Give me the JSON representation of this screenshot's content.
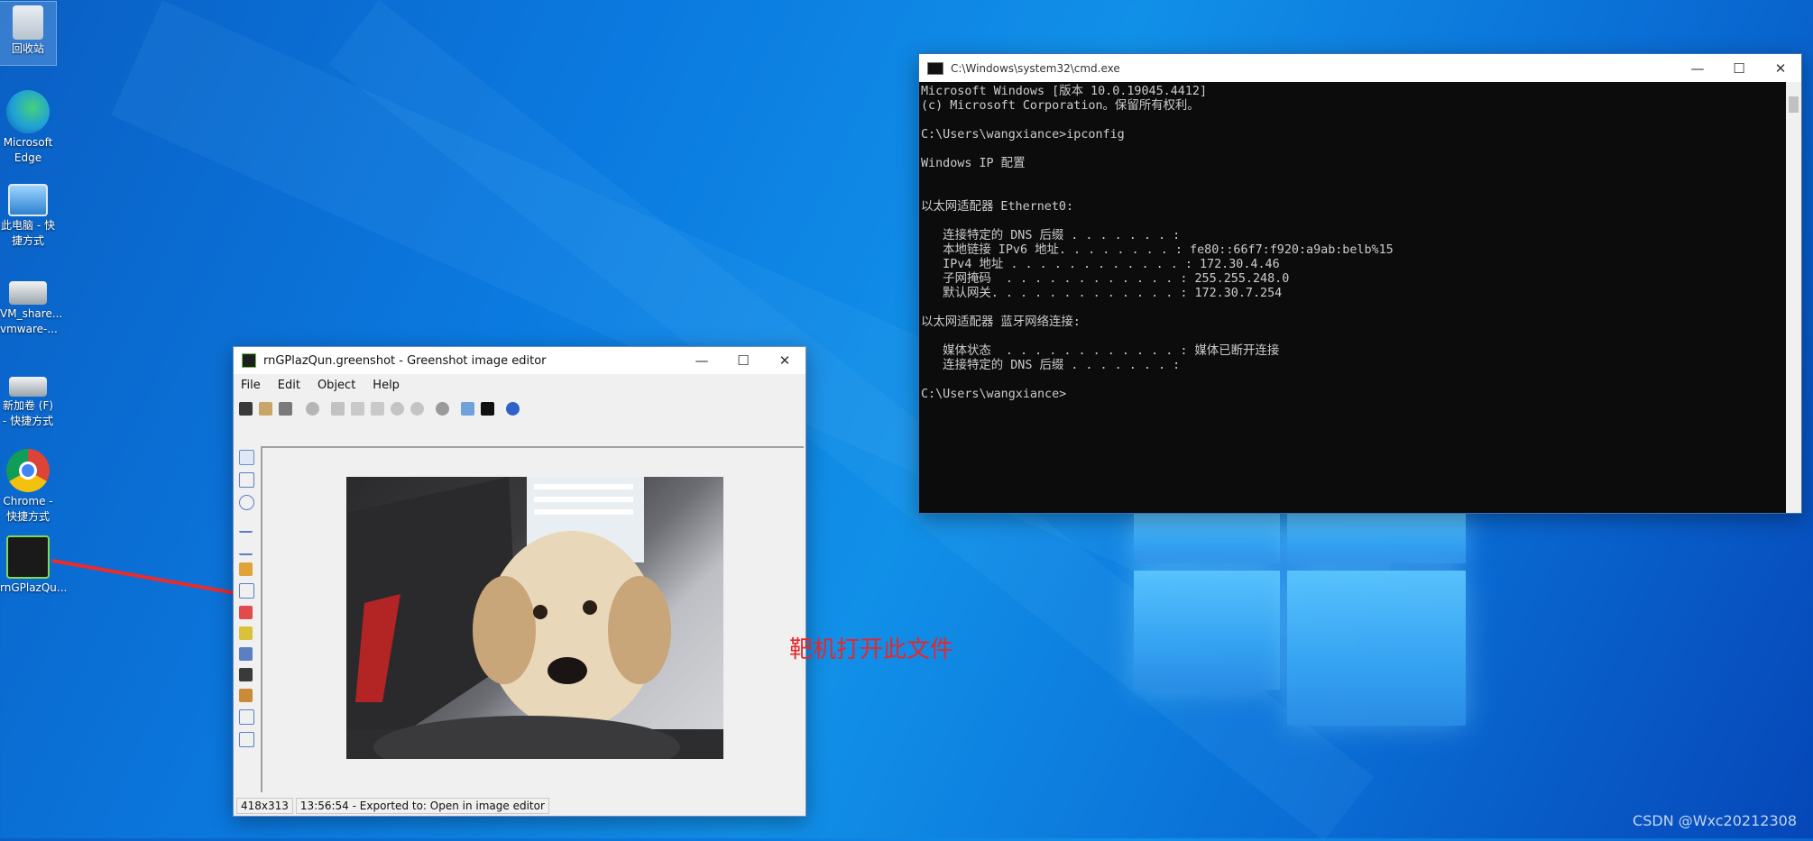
{
  "desktop": {
    "icons": [
      {
        "label": "回收站"
      },
      {
        "label": "Microsoft Edge"
      },
      {
        "label": "此电脑 - 快捷方式"
      },
      {
        "label": "VM_share... vmware-..."
      },
      {
        "label": "新加卷 (F) - 快捷方式"
      },
      {
        "label": "Chrome - 快捷方式"
      },
      {
        "label": "rnGPlazQu..."
      }
    ],
    "annotation_text": "靶机打开此文件",
    "watermark": "CSDN @Wxc20212308"
  },
  "cmd": {
    "title": "C:\\Windows\\system32\\cmd.exe",
    "lines": [
      "Microsoft Windows [版本 10.0.19045.4412]",
      "(c) Microsoft Corporation。保留所有权利。",
      "",
      "C:\\Users\\wangxiance>ipconfig",
      "",
      "Windows IP 配置",
      "",
      "",
      "以太网适配器 Ethernet0:",
      "",
      "   连接特定的 DNS 后缀 . . . . . . . :",
      "   本地链接 IPv6 地址. . . . . . . . : fe80::66f7:f920:a9ab:belb%15",
      "   IPv4 地址 . . . . . . . . . . . . : 172.30.4.46",
      "   子网掩码  . . . . . . . . . . . . : 255.255.248.0",
      "   默认网关. . . . . . . . . . . . . : 172.30.7.254",
      "",
      "以太网适配器 蓝牙网络连接:",
      "",
      "   媒体状态  . . . . . . . . . . . . : 媒体已断开连接",
      "   连接特定的 DNS 后缀 . . . . . . . :",
      "",
      "C:\\Users\\wangxiance>"
    ]
  },
  "greenshot": {
    "title": "rnGPlazQun.greenshot - Greenshot image editor",
    "menu": [
      "File",
      "Edit",
      "Object",
      "Help"
    ],
    "status_size": "418x313",
    "status_message": "13:56:54 - Exported to: Open in image editor"
  },
  "window_controls": {
    "minimize": "—",
    "maximize": "☐",
    "close": "✕"
  }
}
